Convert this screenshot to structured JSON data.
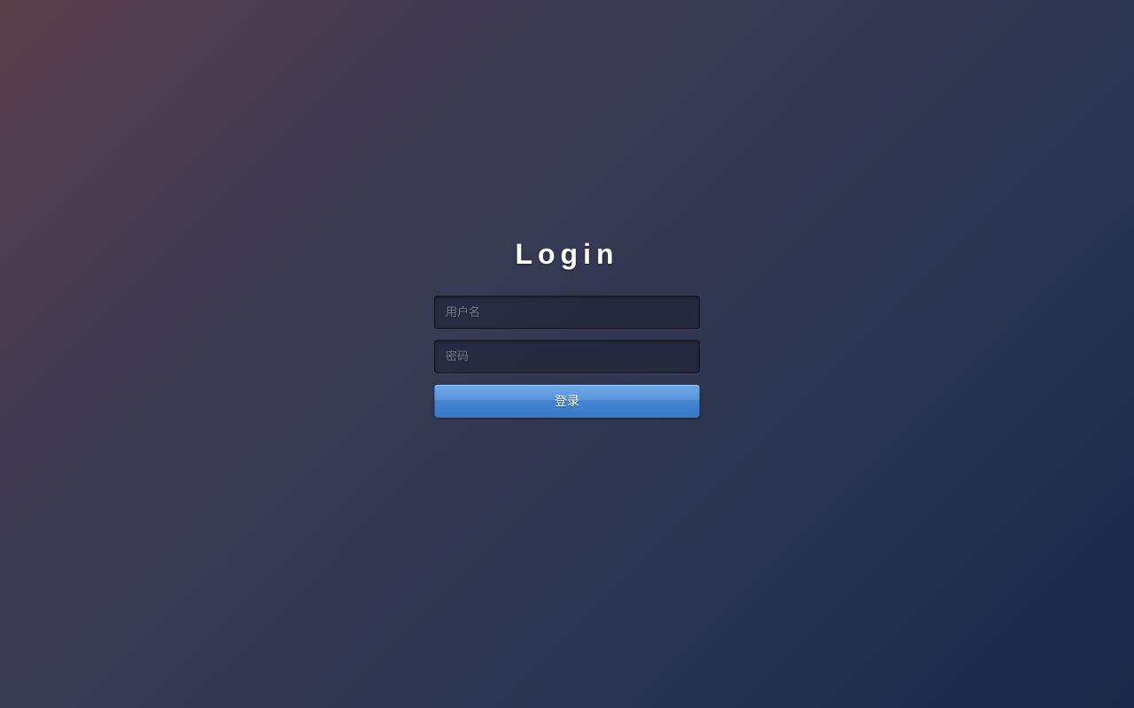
{
  "login": {
    "title": "Login",
    "username_placeholder": "用户名",
    "password_placeholder": "密码",
    "submit_label": "登录"
  }
}
